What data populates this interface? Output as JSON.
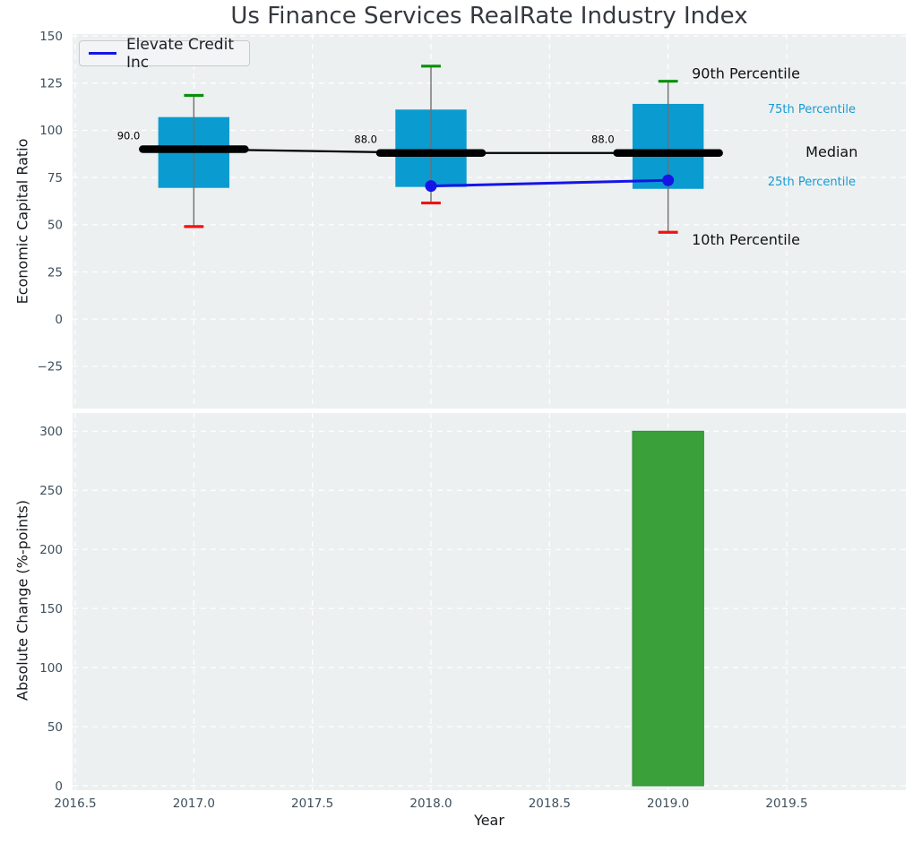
{
  "palette": {
    "plot_bg": "#ecf0f1",
    "grid": "#ffffff",
    "box_fill": "#0a9bd0",
    "p90_cap": "#0b8f0b",
    "p10_cap": "#f01212",
    "median_color": "#000000",
    "whisker": "#707070",
    "series_blue": "#1515e6",
    "bar_fill": "#3aa03a",
    "bar_edge": "#2f8f35",
    "tick_color": "#3d4f5d",
    "text_color": "#16191d",
    "annotation_cyan": "#169bd5",
    "annotation_dark": "#111111",
    "title_color": "#35393f"
  },
  "chart_data": [
    {
      "type": "box",
      "title": "Us Finance Services RealRate Industry Index",
      "ylabel": "Economic Capital Ratio",
      "xlabel": "",
      "grid": true,
      "legend_position": "upper left",
      "legend_entries": [
        {
          "label": "Elevate Credit Inc",
          "color": "#1515e6"
        }
      ],
      "ylim": [
        -47.4,
        151
      ],
      "xlim": [
        2016.4887,
        2020.0025
      ],
      "ytick_values": [
        150,
        125,
        100,
        75,
        50,
        25,
        0,
        -25
      ],
      "ytick_labels": [
        "150",
        "125",
        "100",
        "75",
        "50",
        "25",
        "0",
        "−25"
      ],
      "xtick_values": [
        2016.5,
        2017,
        2017.5,
        2018,
        2018.5,
        2019,
        2019.5
      ],
      "box_width": 0.3,
      "boxes": [
        {
          "x": 2017,
          "p10": 49,
          "p25": 69.5,
          "median": 90,
          "p75": 107,
          "p90": 118.5,
          "median_label": "90.0"
        },
        {
          "x": 2018,
          "p10": 61.5,
          "p25": 70,
          "median": 88,
          "p75": 111,
          "p90": 134,
          "median_label": "88.0"
        },
        {
          "x": 2019,
          "p10": 46,
          "p25": 69,
          "median": 88,
          "p75": 114,
          "p90": 126,
          "median_label": "88.0"
        }
      ],
      "median_line": {
        "points": [
          [
            2017,
            90
          ],
          [
            2018,
            88
          ],
          [
            2019,
            88
          ]
        ]
      },
      "series": [
        {
          "name": "Elevate Credit Inc",
          "color": "#1515e6",
          "marker": "circle",
          "points": [
            [
              2018,
              70.5
            ],
            [
              2019,
              73.5
            ]
          ]
        }
      ],
      "annotations": [
        {
          "text": "90th Percentile",
          "x": 2019.1,
          "y": 130,
          "size": "large",
          "color": "#111111"
        },
        {
          "text": "75th Percentile",
          "x": 2019.42,
          "y": 111,
          "size": "small",
          "color": "#169bd5"
        },
        {
          "text": "Median",
          "x": 2019.58,
          "y": 88.5,
          "size": "large",
          "color": "#111111"
        },
        {
          "text": "25th Percentile",
          "x": 2019.42,
          "y": 72.5,
          "size": "small",
          "color": "#169bd5"
        },
        {
          "text": "10th Percentile",
          "x": 2019.1,
          "y": 42,
          "size": "large",
          "color": "#111111"
        }
      ]
    },
    {
      "type": "bar",
      "ylabel": "Absolute Change (%-points)",
      "xlabel": "Year",
      "grid": true,
      "ylim": [
        -3.8,
        315.4
      ],
      "xlim": [
        2016.4887,
        2020.0025
      ],
      "ytick_values": [
        300,
        250,
        200,
        150,
        100,
        50,
        0
      ],
      "ytick_labels": [
        "300",
        "250",
        "200",
        "150",
        "100",
        "50",
        "0"
      ],
      "xtick_values": [
        2016.5,
        2017,
        2017.5,
        2018,
        2018.5,
        2019,
        2019.5
      ],
      "xtick_labels": [
        "2016.5",
        "2017.0",
        "2017.5",
        "2018.0",
        "2018.5",
        "2019.0",
        "2019.5"
      ],
      "bar_width": 0.3,
      "bars": [
        {
          "x": 2019,
          "value": 300,
          "color": "#3aa03a"
        }
      ]
    }
  ]
}
